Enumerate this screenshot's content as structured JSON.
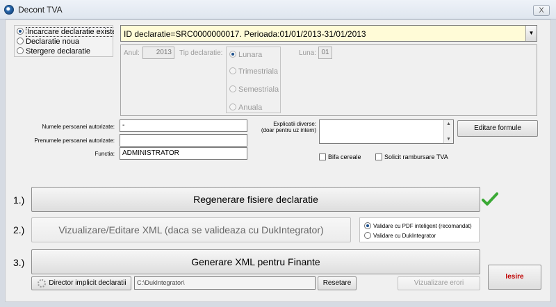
{
  "window": {
    "title": "Decont TVA",
    "close_label": "X"
  },
  "mode": {
    "options": [
      {
        "label": "Incarcare declaratie existenta",
        "selected": true
      },
      {
        "label": "Declaratie noua",
        "selected": false
      },
      {
        "label": "Stergere declaratie",
        "selected": false
      }
    ]
  },
  "declaration": {
    "selected": "ID declaratie=SRC0000000017. Perioada:01/01/2013-31/01/2013",
    "dropdown_icon": "chevron-down-icon"
  },
  "details": {
    "year_label": "Anul:",
    "year_value": "2013",
    "type_label": "Tip declaratie:",
    "type_options": [
      {
        "label": "Lunara",
        "selected": true
      },
      {
        "label": "Trimestriala",
        "selected": false
      },
      {
        "label": "Semestriala",
        "selected": false
      },
      {
        "label": "Anuala",
        "selected": false
      }
    ],
    "month_label": "Luna:",
    "month_value": "01"
  },
  "person": {
    "name_label": "Numele persoanei autorizate:",
    "name_value": "-",
    "firstname_label": "Prenumele persoanei autorizate:",
    "firstname_value": "",
    "function_label": "Functia:",
    "function_value": "ADMINISTRATOR"
  },
  "notes": {
    "label_line1": "Explicatii diverse:",
    "label_line2": "(doar pentru uz intern)",
    "value": ""
  },
  "edit_formulas_label": "Editare formule",
  "checks": {
    "cereals_label": "Bifa cereale",
    "refund_label": "Solicit rambursare TVA"
  },
  "steps": {
    "step1_label": "1.)",
    "step1_button": "Regenerare fisiere declaratie",
    "step1_status_icon": "check-icon",
    "step2_label": "2.)",
    "step2_button": "Vizualizare/Editare XML (daca se valideaza cu DukIntegrator)",
    "step3_label": "3.)",
    "step3_button": "Generare XML pentru Finante"
  },
  "validation": {
    "options": [
      {
        "label": "Validare cu PDF inteligent (recomandat)",
        "selected": true
      },
      {
        "label": "Validare cu DukIntegrator",
        "selected": false
      }
    ]
  },
  "directory": {
    "button_label": "Director implicit declaratii",
    "path": "C:\\DukIntegrator\\",
    "reset_label": "Resetare"
  },
  "errors_button": "Vizualizare erori",
  "exit_button": "Iesire",
  "colors": {
    "combo_bg": "#fffbd7",
    "exit_text": "#c00000",
    "check": "#3aa935"
  }
}
